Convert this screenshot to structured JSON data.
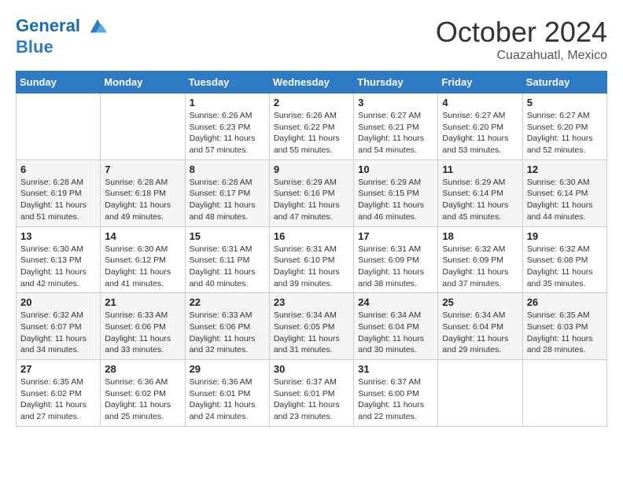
{
  "logo": {
    "line1": "General",
    "line2": "Blue"
  },
  "title": "October 2024",
  "subtitle": "Cuazahuatl, Mexico",
  "weekdays": [
    "Sunday",
    "Monday",
    "Tuesday",
    "Wednesday",
    "Thursday",
    "Friday",
    "Saturday"
  ],
  "weeks": [
    [
      null,
      null,
      {
        "day": 1,
        "sunrise": "6:26 AM",
        "sunset": "6:23 PM",
        "daylight": "11 hours and 57 minutes."
      },
      {
        "day": 2,
        "sunrise": "6:26 AM",
        "sunset": "6:22 PM",
        "daylight": "11 hours and 55 minutes."
      },
      {
        "day": 3,
        "sunrise": "6:27 AM",
        "sunset": "6:21 PM",
        "daylight": "11 hours and 54 minutes."
      },
      {
        "day": 4,
        "sunrise": "6:27 AM",
        "sunset": "6:20 PM",
        "daylight": "11 hours and 53 minutes."
      },
      {
        "day": 5,
        "sunrise": "6:27 AM",
        "sunset": "6:20 PM",
        "daylight": "11 hours and 52 minutes."
      }
    ],
    [
      {
        "day": 6,
        "sunrise": "6:28 AM",
        "sunset": "6:19 PM",
        "daylight": "11 hours and 51 minutes."
      },
      {
        "day": 7,
        "sunrise": "6:28 AM",
        "sunset": "6:18 PM",
        "daylight": "11 hours and 49 minutes."
      },
      {
        "day": 8,
        "sunrise": "6:28 AM",
        "sunset": "6:17 PM",
        "daylight": "11 hours and 48 minutes."
      },
      {
        "day": 9,
        "sunrise": "6:29 AM",
        "sunset": "6:16 PM",
        "daylight": "11 hours and 47 minutes."
      },
      {
        "day": 10,
        "sunrise": "6:29 AM",
        "sunset": "6:15 PM",
        "daylight": "11 hours and 46 minutes."
      },
      {
        "day": 11,
        "sunrise": "6:29 AM",
        "sunset": "6:14 PM",
        "daylight": "11 hours and 45 minutes."
      },
      {
        "day": 12,
        "sunrise": "6:30 AM",
        "sunset": "6:14 PM",
        "daylight": "11 hours and 44 minutes."
      }
    ],
    [
      {
        "day": 13,
        "sunrise": "6:30 AM",
        "sunset": "6:13 PM",
        "daylight": "11 hours and 42 minutes."
      },
      {
        "day": 14,
        "sunrise": "6:30 AM",
        "sunset": "6:12 PM",
        "daylight": "11 hours and 41 minutes."
      },
      {
        "day": 15,
        "sunrise": "6:31 AM",
        "sunset": "6:11 PM",
        "daylight": "11 hours and 40 minutes."
      },
      {
        "day": 16,
        "sunrise": "6:31 AM",
        "sunset": "6:10 PM",
        "daylight": "11 hours and 39 minutes."
      },
      {
        "day": 17,
        "sunrise": "6:31 AM",
        "sunset": "6:09 PM",
        "daylight": "11 hours and 38 minutes."
      },
      {
        "day": 18,
        "sunrise": "6:32 AM",
        "sunset": "6:09 PM",
        "daylight": "11 hours and 37 minutes."
      },
      {
        "day": 19,
        "sunrise": "6:32 AM",
        "sunset": "6:08 PM",
        "daylight": "11 hours and 35 minutes."
      }
    ],
    [
      {
        "day": 20,
        "sunrise": "6:32 AM",
        "sunset": "6:07 PM",
        "daylight": "11 hours and 34 minutes."
      },
      {
        "day": 21,
        "sunrise": "6:33 AM",
        "sunset": "6:06 PM",
        "daylight": "11 hours and 33 minutes."
      },
      {
        "day": 22,
        "sunrise": "6:33 AM",
        "sunset": "6:06 PM",
        "daylight": "11 hours and 32 minutes."
      },
      {
        "day": 23,
        "sunrise": "6:34 AM",
        "sunset": "6:05 PM",
        "daylight": "11 hours and 31 minutes."
      },
      {
        "day": 24,
        "sunrise": "6:34 AM",
        "sunset": "6:04 PM",
        "daylight": "11 hours and 30 minutes."
      },
      {
        "day": 25,
        "sunrise": "6:34 AM",
        "sunset": "6:04 PM",
        "daylight": "11 hours and 29 minutes."
      },
      {
        "day": 26,
        "sunrise": "6:35 AM",
        "sunset": "6:03 PM",
        "daylight": "11 hours and 28 minutes."
      }
    ],
    [
      {
        "day": 27,
        "sunrise": "6:35 AM",
        "sunset": "6:02 PM",
        "daylight": "11 hours and 27 minutes."
      },
      {
        "day": 28,
        "sunrise": "6:36 AM",
        "sunset": "6:02 PM",
        "daylight": "11 hours and 25 minutes."
      },
      {
        "day": 29,
        "sunrise": "6:36 AM",
        "sunset": "6:01 PM",
        "daylight": "11 hours and 24 minutes."
      },
      {
        "day": 30,
        "sunrise": "6:37 AM",
        "sunset": "6:01 PM",
        "daylight": "11 hours and 23 minutes."
      },
      {
        "day": 31,
        "sunrise": "6:37 AM",
        "sunset": "6:00 PM",
        "daylight": "11 hours and 22 minutes."
      },
      null,
      null
    ]
  ]
}
